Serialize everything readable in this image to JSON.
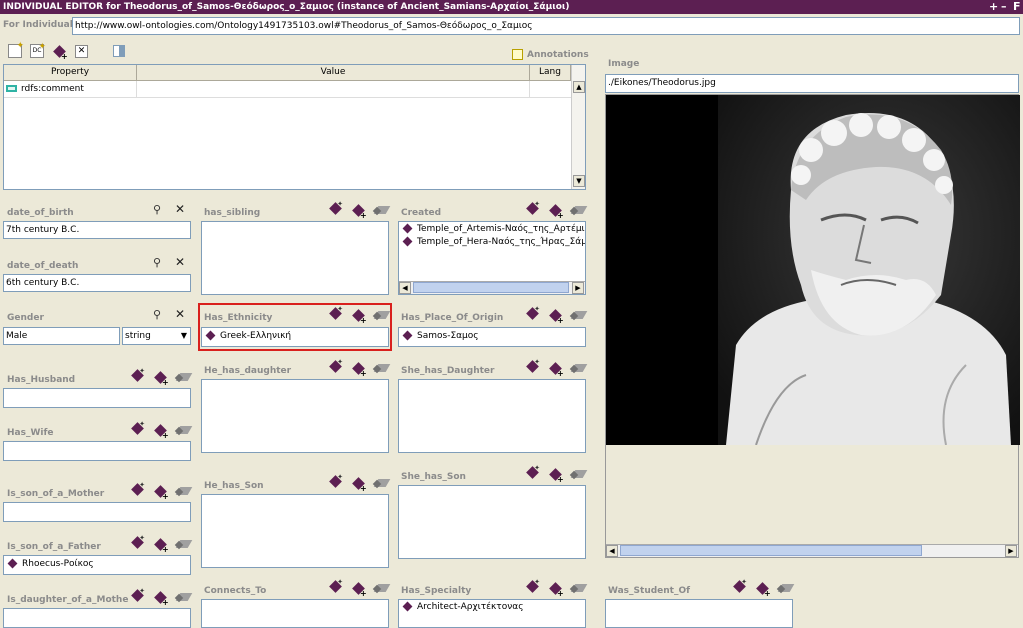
{
  "window": {
    "title": "INDIVIDUAL EDITOR for Theodorus_of_Samos-Θεόδωρος_ο_Σαμιος  (instance of Ancient_Samians-Αρχαίοι_Σάμιοι)",
    "controls": [
      "+",
      "–",
      "F"
    ]
  },
  "for_individual": {
    "label": "For Individual:",
    "value": "http://www.owl-ontologies.com/Ontology1491735103.owl#Theodorus_of_Samos-Θεόδωρος_ο_Σαμιος"
  },
  "annotations": {
    "label": "Annotations",
    "columns": [
      "Property",
      "Value",
      "Lang"
    ],
    "rows": [
      {
        "property": "rdfs:comment",
        "value": "",
        "lang": ""
      }
    ]
  },
  "image": {
    "label": "Image",
    "path": "./Eikones/Theodorus.jpg"
  },
  "slots": {
    "date_of_birth": {
      "label": "date_of_birth",
      "value": "7th century B.C."
    },
    "date_of_death": {
      "label": "date_of_death",
      "value": "6th century B.C."
    },
    "gender": {
      "label": "Gender",
      "value": "Male",
      "type": "string"
    },
    "has_husband": {
      "label": "Has_Husband"
    },
    "has_wife": {
      "label": "Has_Wife"
    },
    "is_son_of_a_mother": {
      "label": "Is_son_of_a_Mother"
    },
    "is_son_of_a_father": {
      "label": "Is_son_of_a_Father",
      "value": "Rhoecus-Ροίκος"
    },
    "is_daughter_of_a_mother": {
      "label": "Is_daughter_of_a_Mothe"
    },
    "has_sibling": {
      "label": "has_sibling"
    },
    "has_ethnicity": {
      "label": "Has_Ethnicity",
      "value": "Greek-Ελληνική"
    },
    "he_has_daughter": {
      "label": "He_has_daughter"
    },
    "he_has_son": {
      "label": "He_has_Son"
    },
    "connects_to": {
      "label": "Connects_To"
    },
    "created": {
      "label": "Created",
      "values": [
        "Temple_of_Artemis-Ναός_της_Αρτέμιδας",
        "Temple_of_Hera-Ναός_της_Ήρας_Σάμου"
      ]
    },
    "has_place_of_origin": {
      "label": "Has_Place_Of_Origin",
      "value": "Samos-Σαμος"
    },
    "she_has_daughter": {
      "label": "She_has_Daughter"
    },
    "she_has_son": {
      "label": "She_has_Son"
    },
    "has_specialty": {
      "label": "Has_Specialty",
      "value": "Architect-Αρχιτέκτονας"
    },
    "was_student_of": {
      "label": "Was_Student_Of"
    }
  },
  "colors": {
    "title_bg": "#5c1f52",
    "highlight": "#d9201d",
    "panel_bg": "#ece9d8"
  }
}
